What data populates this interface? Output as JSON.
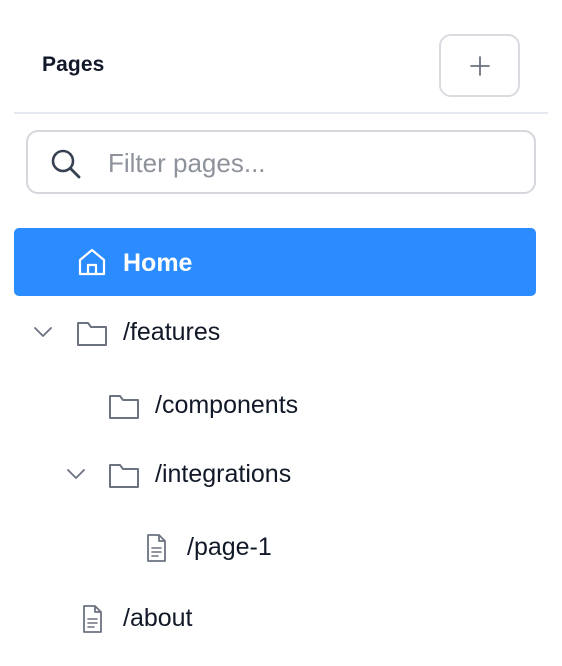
{
  "sidebar": {
    "title": "Pages",
    "add_button_glyph": "+",
    "search": {
      "placeholder": "Filter pages...",
      "value": ""
    },
    "items": [
      {
        "label": "Home",
        "icon": "home-icon",
        "active": true
      },
      {
        "label": "/features",
        "icon": "folder-icon",
        "expanded": true
      },
      {
        "label": "/components",
        "icon": "folder-icon"
      },
      {
        "label": "/integrations",
        "icon": "folder-icon",
        "expanded": true
      },
      {
        "label": "/page-1",
        "icon": "file-icon"
      },
      {
        "label": "/about",
        "icon": "file-icon"
      }
    ]
  },
  "colors": {
    "accent": "#2b8cff",
    "text": "#111827",
    "icon_gray": "#6b7280",
    "border": "#d5d7dc"
  }
}
